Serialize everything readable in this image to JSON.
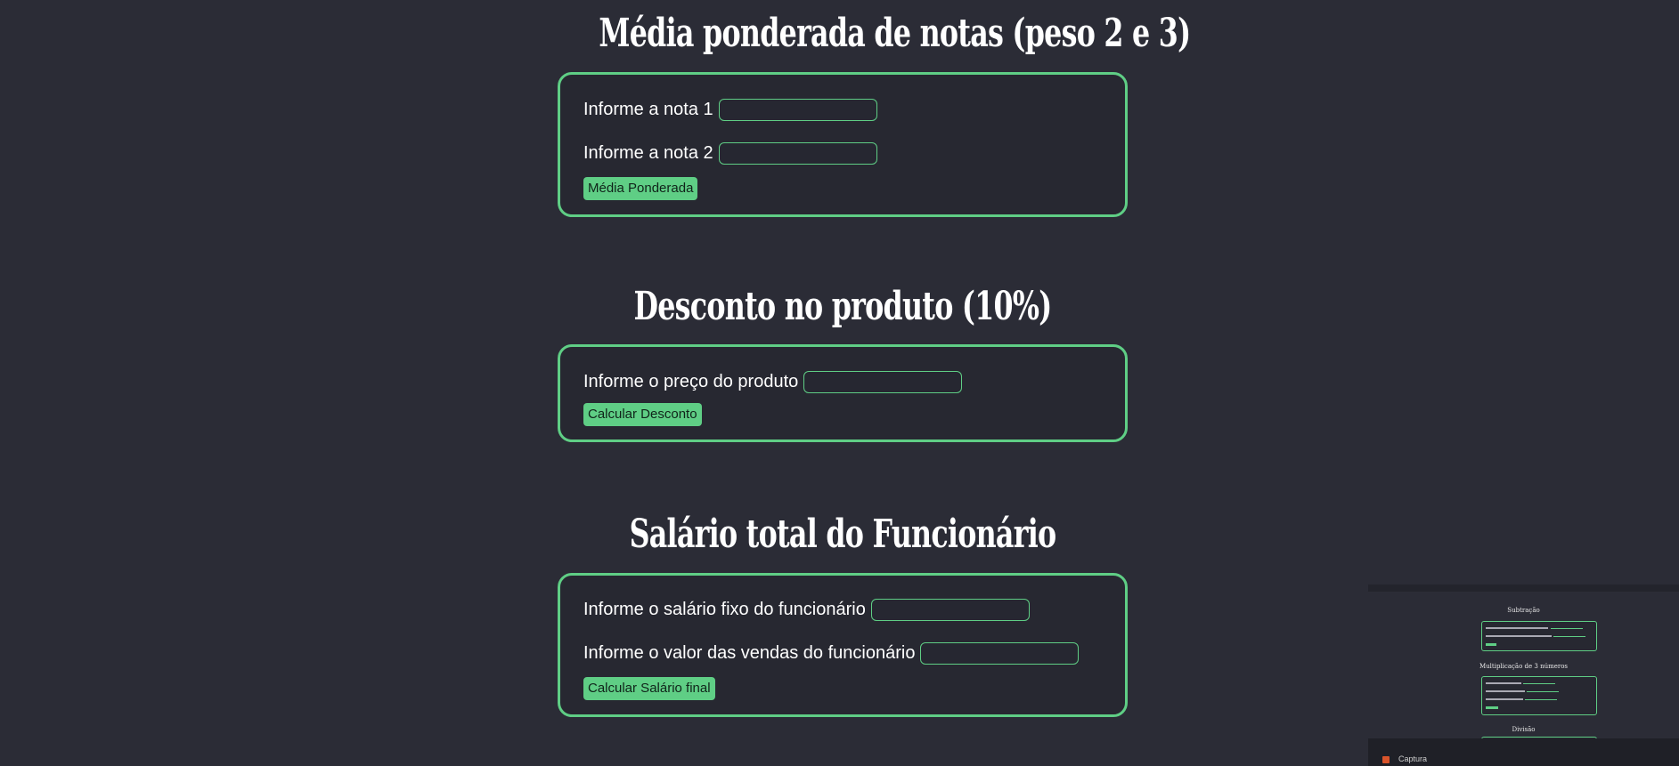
{
  "sections": [
    {
      "title": "Média ponderada de notas (peso 2 e 3)",
      "fields": [
        {
          "label": "Informe a nota 1",
          "value": "",
          "placeholder": ""
        },
        {
          "label": "Informe a nota 2",
          "value": "",
          "placeholder": ""
        }
      ],
      "button": "Média Ponderada"
    },
    {
      "title": "Desconto no produto (10%)",
      "fields": [
        {
          "label": "Informe o preço do produto",
          "value": "",
          "placeholder": ""
        }
      ],
      "button": "Calcular Desconto"
    },
    {
      "title": "Salário total do Funcionário",
      "fields": [
        {
          "label": "Informe o salário fixo do funcionário",
          "value": "",
          "placeholder": ""
        },
        {
          "label": "Informe o valor das vendas do funcionário",
          "value": "",
          "placeholder": ""
        }
      ],
      "button": "Calcular Salário final"
    }
  ],
  "thumbnail": {
    "section_titles": [
      "Subtração",
      "Multiplicação de 3 números",
      "Divisão"
    ],
    "taskbar_label": "Captura"
  },
  "colors": {
    "background": "#2b2c36",
    "card_background": "#272831",
    "accent": "#5fce85",
    "text": "#ffffff"
  }
}
